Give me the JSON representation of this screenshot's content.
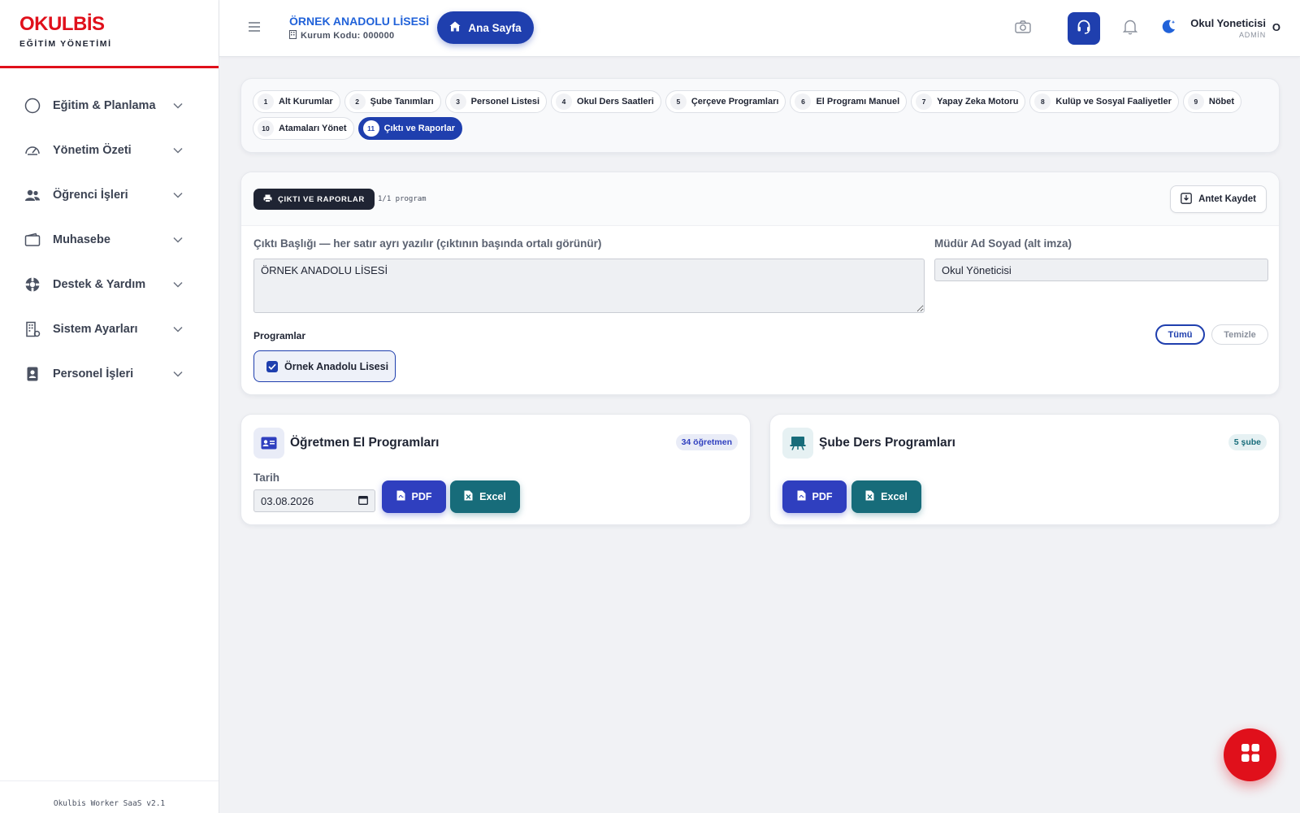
{
  "brand": {
    "name": "OKULBİS",
    "subtitle": "EĞİTİM YÖNETİMİ"
  },
  "sidebar": {
    "items": [
      {
        "label": "Eğitim & Planlama",
        "icon": "circle-icon"
      },
      {
        "label": "Yönetim Özeti",
        "icon": "gauge-icon"
      },
      {
        "label": "Öğrenci İşleri",
        "icon": "users-icon"
      },
      {
        "label": "Muhasebe",
        "icon": "wallet-icon"
      },
      {
        "label": "Destek & Yardım",
        "icon": "lifebuoy-icon"
      },
      {
        "label": "Sistem Ayarları",
        "icon": "building-gear-icon"
      },
      {
        "label": "Personel İşleri",
        "icon": "id-badge-icon"
      }
    ],
    "footer": "Okulbis Worker SaaS v2.1"
  },
  "header": {
    "school_name": "ÖRNEK ANADOLU LİSESİ",
    "school_code": "Kurum Kodu: 000000",
    "home_label": "Ana Sayfa",
    "user_name": "Okul Yoneticisi",
    "user_role": "ADMİN",
    "user_initial": "O"
  },
  "steps": [
    {
      "num": "1",
      "label": "Alt Kurumlar"
    },
    {
      "num": "2",
      "label": "Şube Tanımları"
    },
    {
      "num": "3",
      "label": "Personel Listesi"
    },
    {
      "num": "4",
      "label": "Okul Ders Saatleri"
    },
    {
      "num": "5",
      "label": "Çerçeve Programları"
    },
    {
      "num": "6",
      "label": "El Programı Manuel"
    },
    {
      "num": "7",
      "label": "Yapay Zeka Motoru"
    },
    {
      "num": "8",
      "label": "Kulüp ve Sosyal Faaliyetler"
    },
    {
      "num": "9",
      "label": "Nöbet"
    },
    {
      "num": "10",
      "label": "Atamaları Yönet"
    },
    {
      "num": "11",
      "label": "Çıktı ve Raporlar"
    }
  ],
  "settings": {
    "badge": "ÇIKTI VE RAPORLAR",
    "program_count": "1/1 program",
    "antet_label": "Antet Kaydet",
    "title_label": "Çıktı Başlığı — her satır ayrı yazılır (çıktının başında ortalı görünür)",
    "title_value": "ÖRNEK ANADOLU LİSESİ",
    "principal_label": "Müdür Ad Soyad (alt imza)",
    "principal_value": "Okul Yöneticisi",
    "programs_label": "Programlar",
    "all_label": "Tümü",
    "clear_label": "Temizle",
    "program_item": "Örnek Anadolu Lisesi"
  },
  "teacher_card": {
    "title": "Öğretmen El Programları",
    "count": "34 öğretmen",
    "date_label": "Tarih",
    "date_value": "03.08.2026",
    "pdf_label": "PDF",
    "excel_label": "Excel"
  },
  "class_card": {
    "title": "Şube Ders Programları",
    "count": "5 şube",
    "pdf_label": "PDF",
    "excel_label": "Excel"
  },
  "colors": {
    "brand_red": "#e0101b",
    "primary_blue": "#1f3fae",
    "teal": "#176c7a"
  }
}
